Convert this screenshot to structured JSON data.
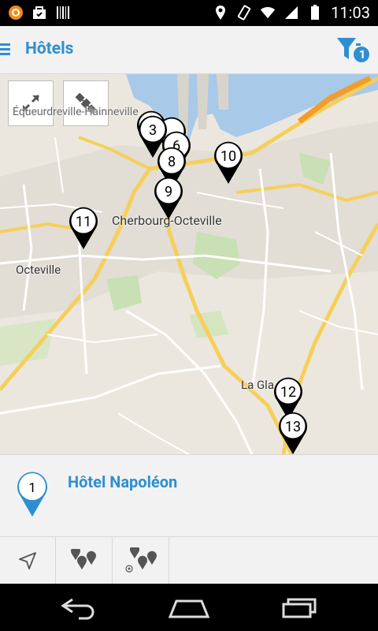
{
  "status_bar": {
    "time": "11:03",
    "icons_left": [
      "avast-icon",
      "bag-icon",
      "barcode-icon"
    ],
    "icons_right": [
      "location-icon",
      "vibrate-icon",
      "wifi-icon",
      "signal-icon",
      "battery-icon"
    ]
  },
  "app_bar": {
    "title": "Hôtels",
    "filter_badge": "1"
  },
  "map": {
    "labels": {
      "city": "Cherbourg-Octeville",
      "octeville": "Octeville",
      "la_glacerie": "La Gla",
      "equeurdreville": "Équeurdreville-Hainneville"
    },
    "markers": [
      "3",
      "6",
      "8",
      "9",
      "10",
      "11",
      "12",
      "13"
    ],
    "controls": [
      "expand-icon",
      "satellite-icon"
    ]
  },
  "selected_hotel": {
    "number": "1",
    "name": "Hôtel Napoléon",
    "accent_color": "#2e8fd0"
  },
  "bottom_toolbar": {
    "buttons": [
      "navigate-icon",
      "nearby-hotels-icon",
      "hotels-around-me-icon"
    ]
  },
  "nav_bar": {
    "buttons": [
      "back-icon",
      "home-icon",
      "recent-apps-icon"
    ]
  }
}
